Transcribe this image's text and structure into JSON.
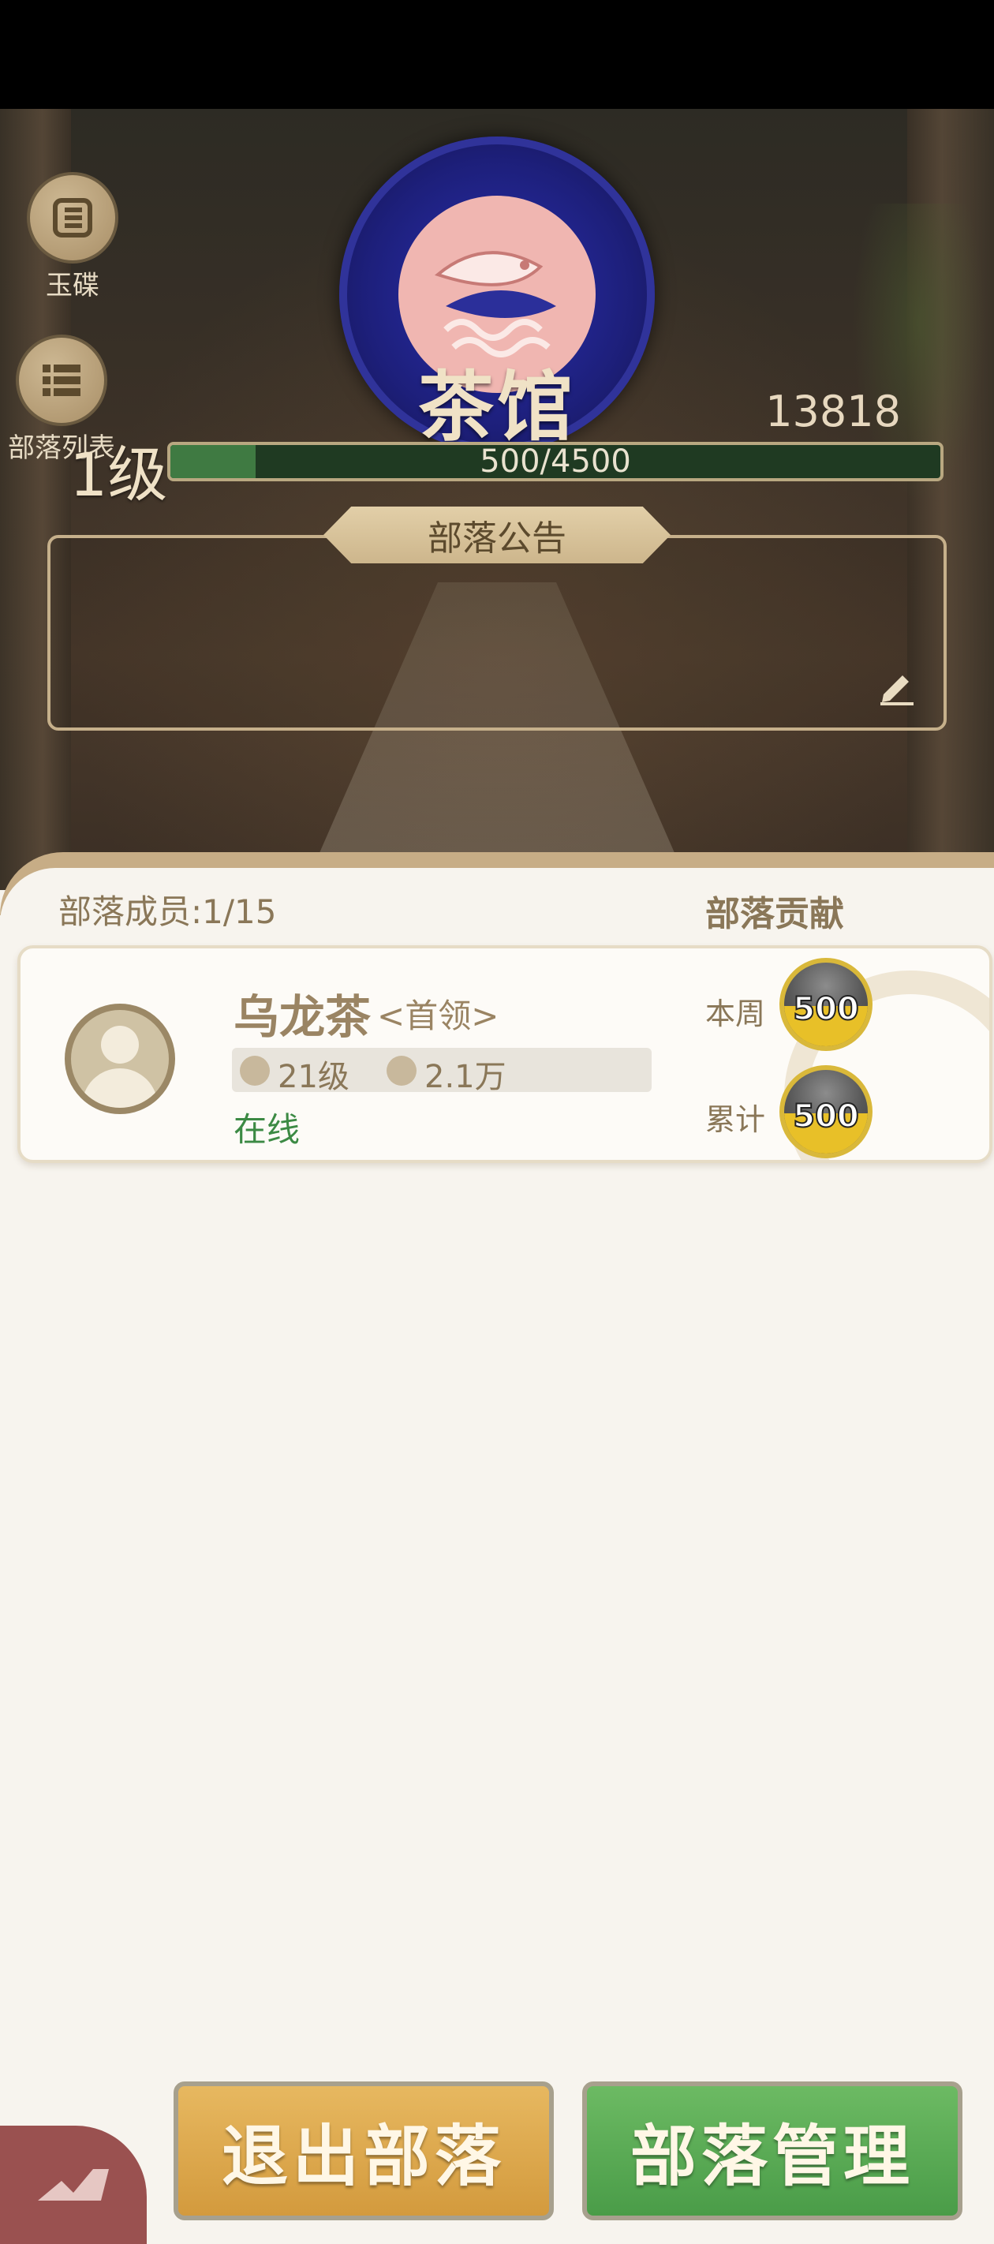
{
  "header": {
    "side_buttons": [
      {
        "label": "玉碟",
        "icon": "jade-scroll-icon"
      },
      {
        "label": "部落列表",
        "icon": "list-icon"
      }
    ],
    "tribe_name": "茶馆",
    "tribe_score": "13818",
    "level_label": "1级",
    "xp": {
      "current": 500,
      "max": 4500,
      "text": "500/4500",
      "fill_fraction": 0.111
    }
  },
  "notice": {
    "title": "部落公告",
    "content": "",
    "edit_icon": "pencil-icon"
  },
  "members": {
    "label": "部落成员:1/15",
    "contribution_label": "部落贡献",
    "list": [
      {
        "name": "乌龙茶",
        "role": "<首领>",
        "level": "21级",
        "power": "2.1万",
        "status": "在线",
        "weekly_label": "本周",
        "weekly_value": "500",
        "total_label": "累计",
        "total_value": "500"
      }
    ]
  },
  "actions": {
    "exit_label": "退出部落",
    "manage_label": "部落管理"
  },
  "colors": {
    "exit": "#d9a448",
    "manage": "#58a954",
    "online": "#3c8a44",
    "emblem": "#23279a"
  }
}
